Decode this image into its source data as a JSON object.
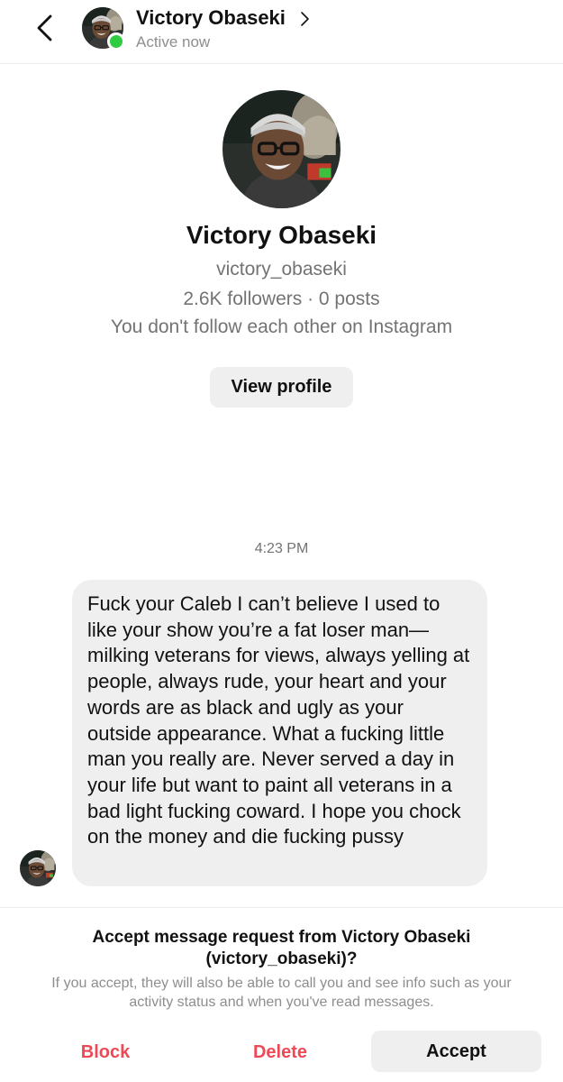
{
  "header": {
    "back_icon": "chevron-left-icon",
    "name": "Victory Obaseki",
    "status": "Active now",
    "status_color": "#2ecc40"
  },
  "profile": {
    "name": "Victory Obaseki",
    "username": "victory_obaseki",
    "stats": "2.6K followers · 0 posts",
    "follow_status": "You don't follow each other on Instagram",
    "view_profile_label": "View profile"
  },
  "conversation": {
    "timestamp": "4:23 PM",
    "message": "Fuck your Caleb I can’t believe I used to like your show you’re a fat loser man— milking veterans for views, always yelling at people, always rude, your heart and your words are as black and ugly as your outside appearance. What a fucking little man you really are. Never served a day in your life but want to paint all veterans in a bad light fucking coward. I hope you chock on the money and die fucking pussy"
  },
  "request": {
    "title": "Accept message request from Victory Obaseki (victory_obaseki)?",
    "description": "If you accept, they will also be able to call you and see info such as your activity status and when you've read messages.",
    "block_label": "Block",
    "delete_label": "Delete",
    "accept_label": "Accept",
    "danger_color": "#ed4956"
  }
}
